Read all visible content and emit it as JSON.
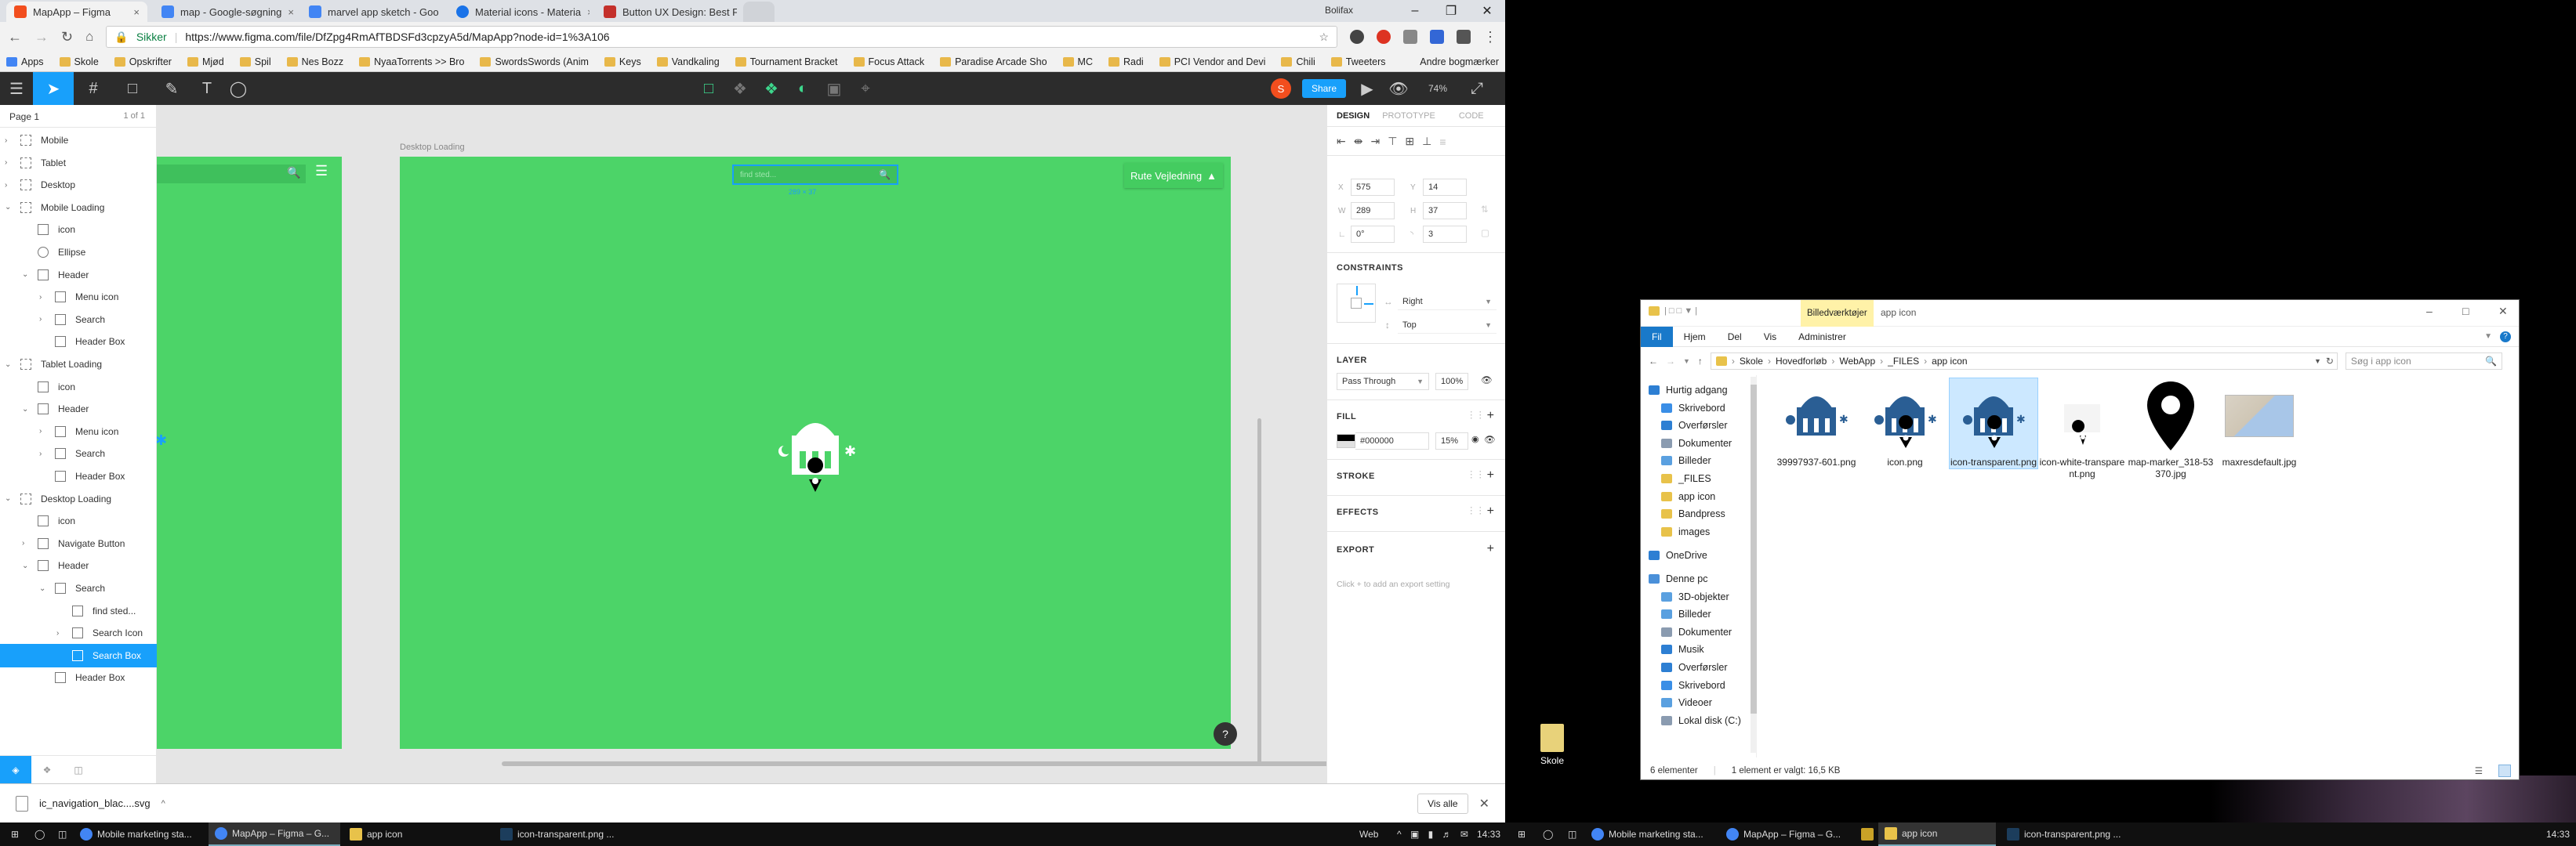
{
  "browser": {
    "tabs": [
      {
        "label": "MapApp – Figma",
        "color": "#f24e1e"
      },
      {
        "label": "map - Google-søgning",
        "color": "#4285f4"
      },
      {
        "label": "marvel app sketch - Goo",
        "color": "#4285f4"
      },
      {
        "label": "Material icons - Materia",
        "color": "#1a73e8"
      },
      {
        "label": "Button UX Design: Best F",
        "color": "#c4302b"
      }
    ],
    "profile_name": "Bolifax",
    "secure_label": "Sikker",
    "url": "https://www.figma.com/file/DfZpg4RmAfTBDSFd3cpzyA5d/MapApp?node-id=1%3A106",
    "bookmarks": [
      "Apps",
      "Skole",
      "Opskrifter",
      "Mjød",
      "Spil",
      "Nes Bozz",
      "NyaaTorrents >> Bro",
      "SwordsSwords (Anim",
      "Keys",
      "Vandkaling",
      "Tournament Bracket",
      "Focus Attack",
      "Paradise Arcade Sho",
      "MC",
      "Radi",
      "PCI Vendor and Devi",
      "Chili",
      "Tweeters"
    ],
    "bookmarks_more": "Andre bogmærker"
  },
  "figma": {
    "share_label": "Share",
    "zoom": "74%",
    "avatar_letter": "S",
    "page_name": "Page 1",
    "page_count": "1 of 1",
    "layers": [
      {
        "label": "Mobile",
        "indent": 0
      },
      {
        "label": "Tablet",
        "indent": 0
      },
      {
        "label": "Desktop",
        "indent": 0
      },
      {
        "label": "Mobile Loading",
        "indent": 0
      },
      {
        "label": "icon",
        "indent": 1
      },
      {
        "label": "Ellipse",
        "indent": 1
      },
      {
        "label": "Header",
        "indent": 1
      },
      {
        "label": "Menu icon",
        "indent": 2
      },
      {
        "label": "Search",
        "indent": 2
      },
      {
        "label": "Header Box",
        "indent": 2
      },
      {
        "label": "Tablet Loading",
        "indent": 0
      },
      {
        "label": "icon",
        "indent": 1
      },
      {
        "label": "Header",
        "indent": 1
      },
      {
        "label": "Menu icon",
        "indent": 2
      },
      {
        "label": "Search",
        "indent": 2
      },
      {
        "label": "Header Box",
        "indent": 2
      },
      {
        "label": "Desktop Loading",
        "indent": 0
      },
      {
        "label": "icon",
        "indent": 1
      },
      {
        "label": "Navigate Button",
        "indent": 1
      },
      {
        "label": "Header",
        "indent": 1
      },
      {
        "label": "Search",
        "indent": 2
      },
      {
        "label": "find sted...",
        "indent": 3
      },
      {
        "label": "Search Icon",
        "indent": 3
      },
      {
        "label": "Search Box",
        "indent": 3,
        "selected": true
      },
      {
        "label": "Header Box",
        "indent": 2
      }
    ],
    "frame_label": "Desktop Loading",
    "search_placeholder": "find sted...",
    "size_badge": "289 × 37",
    "navigate_button": "Rute Vejledning",
    "help": "?",
    "panel_tabs": [
      "DESIGN",
      "PROTOTYPE",
      "CODE"
    ],
    "x": "575",
    "y": "14",
    "w": "289",
    "h": "37",
    "rotation": "0°",
    "radius": "3",
    "constraints_title": "CONSTRAINTS",
    "constraint_h": "Right",
    "constraint_v": "Top",
    "layer_title": "LAYER",
    "blend": "Pass Through",
    "opacity": "100%",
    "fill_title": "FILL",
    "fill_hex": "#000000",
    "fill_opacity": "15%",
    "stroke_title": "STROKE",
    "effects_title": "EFFECTS",
    "export_title": "EXPORT",
    "export_hint": "Click + to add an export setting",
    "colors": {
      "frame_green": "#4cd468",
      "selection": "#18a0fb"
    }
  },
  "download": {
    "file": "ic_navigation_blac....svg",
    "show_all": "Vis alle"
  },
  "explorer": {
    "ribbon_context": "Billedværktøjer",
    "title": "app icon",
    "tabs": [
      "Fil",
      "Hjem",
      "Del",
      "Vis",
      "Administrer"
    ],
    "path": [
      "Skole",
      "Hovedforløb",
      "WebApp",
      "_FILES",
      "app icon"
    ],
    "search_placeholder": "Søg i app icon",
    "nav": [
      {
        "label": "Hurtig adgang",
        "color": "#2d7fd3"
      },
      {
        "label": "Skrivebord",
        "color": "#3a8ee6"
      },
      {
        "label": "Overførsler",
        "color": "#2d7fd3"
      },
      {
        "label": "Dokumenter",
        "color": "#8a9bb0"
      },
      {
        "label": "Billeder",
        "color": "#5aa0e0"
      },
      {
        "label": "_FILES",
        "color": "#e8c24a"
      },
      {
        "label": "app icon",
        "color": "#e8c24a"
      },
      {
        "label": "Bandpress",
        "color": "#e8c24a"
      },
      {
        "label": "images",
        "color": "#e8c24a"
      },
      {
        "label": "OneDrive",
        "color": "#2d7fd3"
      },
      {
        "label": "Denne pc",
        "color": "#4a90d9"
      },
      {
        "label": "3D-objekter",
        "color": "#5aa0e0"
      },
      {
        "label": "Billeder",
        "color": "#5aa0e0"
      },
      {
        "label": "Dokumenter",
        "color": "#8a9bb0"
      },
      {
        "label": "Musik",
        "color": "#2d7fd3"
      },
      {
        "label": "Overførsler",
        "color": "#2d7fd3"
      },
      {
        "label": "Skrivebord",
        "color": "#3a8ee6"
      },
      {
        "label": "Videoer",
        "color": "#5aa0e0"
      },
      {
        "label": "Lokal disk (C:)",
        "color": "#8a9bb0"
      }
    ],
    "files": [
      {
        "name": "39997937-601.png",
        "kind": "color"
      },
      {
        "name": "icon.png",
        "kind": "pin-color"
      },
      {
        "name": "icon-transparent.png",
        "kind": "pin-color",
        "selected": true
      },
      {
        "name": "icon-white-transparent.png",
        "kind": "white"
      },
      {
        "name": "map-marker_318-53370.jpg",
        "kind": "marker"
      },
      {
        "name": "maxresdefault.jpg",
        "kind": "map"
      }
    ],
    "status_count": "6 elementer",
    "status_selected": "1 element er valgt: 16,5 KB"
  },
  "desktop": {
    "icon_label": "Skole"
  },
  "taskbar": {
    "left_items": [
      "Mobile marketing sta...",
      "MapApp – Figma – G...",
      "app icon",
      "icon-transparent.png ..."
    ],
    "right_items": [
      "Mobile marketing sta...",
      "MapApp – Figma – G...",
      "app icon",
      "icon-transparent.png ..."
    ],
    "web_label": "Web",
    "time_left": "14:33",
    "time_right": "14:33"
  }
}
